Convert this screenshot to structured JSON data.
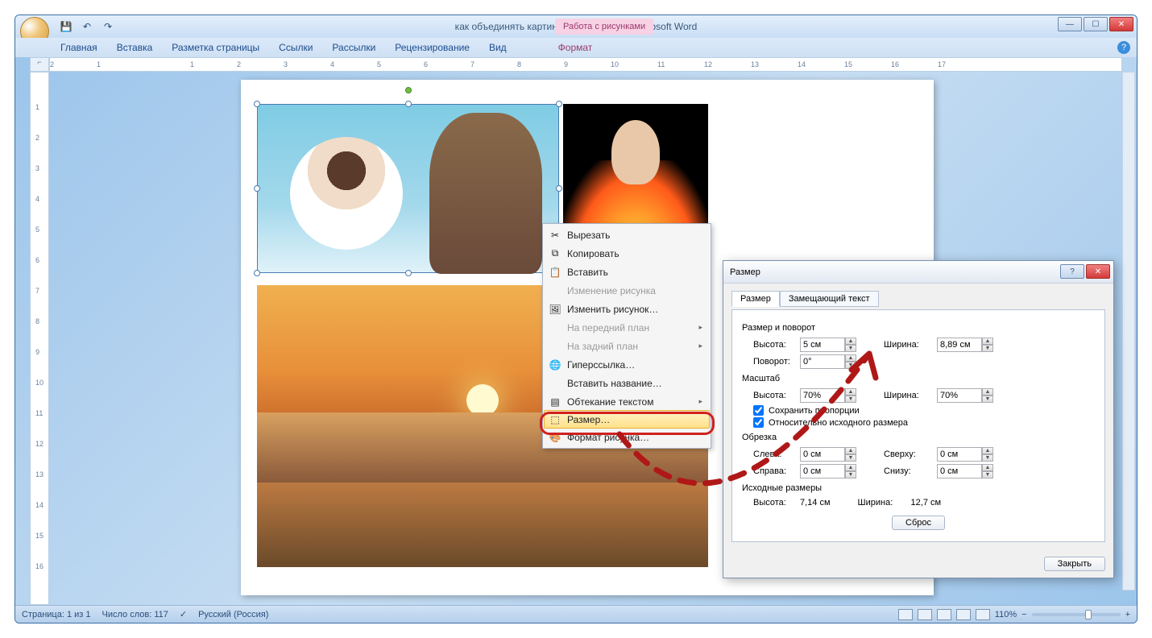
{
  "window": {
    "title": "как объединять картинки в Пэйнт Нет - Microsoft Word",
    "context_tab_group": "Работа с рисунками"
  },
  "ribbon": {
    "tabs": [
      "Главная",
      "Вставка",
      "Разметка страницы",
      "Ссылки",
      "Рассылки",
      "Рецензирование",
      "Вид"
    ],
    "context_tab": "Формат"
  },
  "ruler_h": [
    "2",
    "1",
    "",
    "1",
    "2",
    "3",
    "4",
    "5",
    "6",
    "7",
    "8",
    "9",
    "10",
    "11",
    "12",
    "13",
    "14",
    "15",
    "16",
    "17"
  ],
  "ruler_v": [
    "",
    "1",
    "2",
    "3",
    "4",
    "5",
    "6",
    "7",
    "8",
    "9",
    "10",
    "11",
    "12",
    "13",
    "14",
    "15",
    "16"
  ],
  "context_menu": {
    "cut": "Вырезать",
    "copy": "Копировать",
    "paste": "Вставить",
    "change_image": "Изменение рисунка",
    "replace_image": "Изменить рисунок…",
    "bring_forward": "На передний план",
    "send_backward": "На задний план",
    "hyperlink": "Гиперссылка…",
    "insert_caption": "Вставить название…",
    "text_wrapping": "Обтекание текстом",
    "size": "Размер…",
    "format_picture": "Формат рисунка…"
  },
  "dialog": {
    "title": "Размер",
    "tabs": {
      "size": "Размер",
      "alt_text": "Замещающий текст"
    },
    "group_size_rotate": "Размер и поворот",
    "height_label": "Высота:",
    "width_label": "Ширина:",
    "rotation_label": "Поворот:",
    "height_value": "5 см",
    "width_value": "8,89 см",
    "rotation_value": "0°",
    "group_scale": "Масштаб",
    "scale_h_label": "Высота:",
    "scale_w_label": "Ширина:",
    "scale_h_value": "70%",
    "scale_w_value": "70%",
    "lock_aspect": "Сохранить пропорции",
    "relative_original": "Относительно исходного размера",
    "group_crop": "Обрезка",
    "crop_left_label": "Слева:",
    "crop_right_label": "Справа:",
    "crop_top_label": "Сверху:",
    "crop_bottom_label": "Снизу:",
    "crop_left_value": "0 см",
    "crop_right_value": "0 см",
    "crop_top_value": "0 см",
    "crop_bottom_value": "0 см",
    "group_original": "Исходные размеры",
    "original_height_label": "Высота:",
    "original_width_label": "Ширина:",
    "original_height_value": "7,14 см",
    "original_width_value": "12,7 см",
    "reset": "Сброс",
    "close": "Закрыть"
  },
  "status": {
    "page": "Страница: 1 из 1",
    "words": "Число слов: 117",
    "language": "Русский (Россия)",
    "zoom": "110%"
  }
}
